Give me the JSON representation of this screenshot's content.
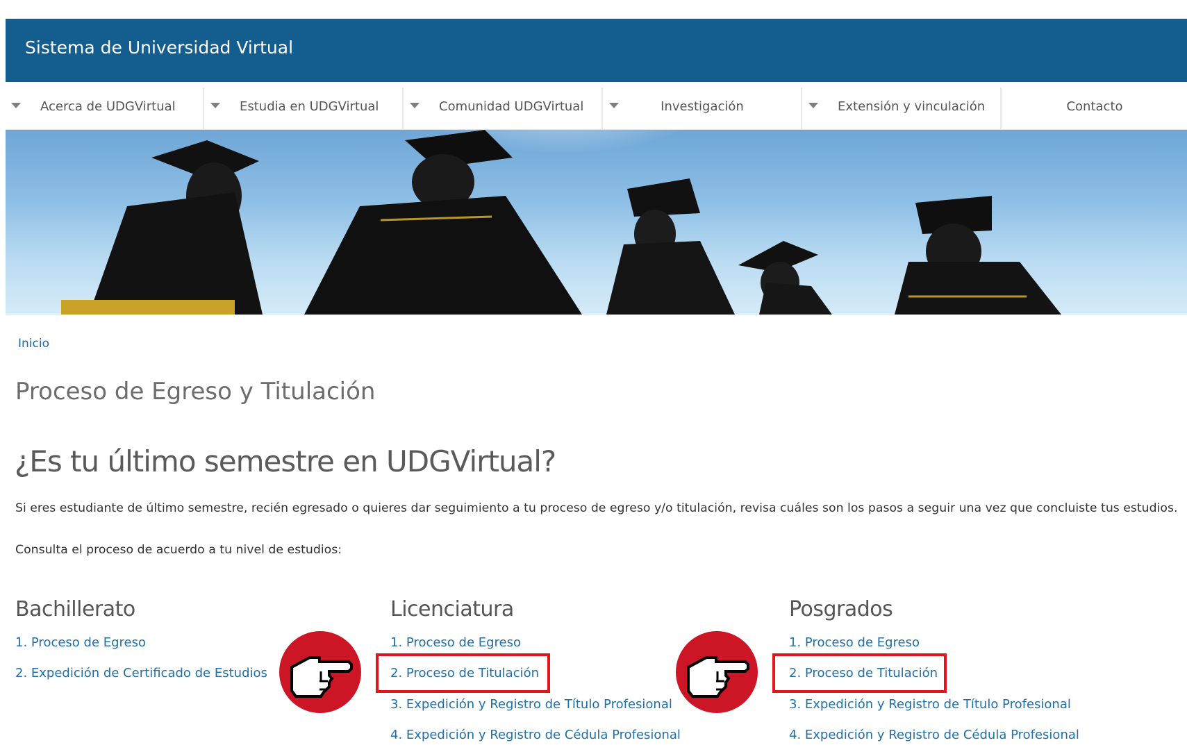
{
  "header": {
    "site_title": "Sistema de Universidad Virtual"
  },
  "nav": {
    "items": [
      {
        "label": "Acerca de UDGVirtual",
        "has_caret": true
      },
      {
        "label": "Estudia en UDGVirtual",
        "has_caret": true
      },
      {
        "label": "Comunidad UDGVirtual",
        "has_caret": true
      },
      {
        "label": "Investigación",
        "has_caret": true
      },
      {
        "label": "Extensión y vinculación",
        "has_caret": true
      },
      {
        "label": "Contacto",
        "has_caret": false
      }
    ]
  },
  "breadcrumb": {
    "home": "Inicio"
  },
  "page": {
    "title": "Proceso de Egreso y Titulación",
    "heading": "¿Es tu último semestre en UDGVirtual?",
    "intro": "Si eres estudiante de último semestre, recién egresado o quieres dar seguimiento a tu proceso de egreso y/o titulación, revisa cuáles son los pasos a seguir una vez que concluiste tus estudios.",
    "consult": "Consulta el proceso de acuerdo a tu nivel de estudios:"
  },
  "columns": [
    {
      "heading": "Bachillerato",
      "links": [
        "1. Proceso de Egreso",
        "2. Expedición de Certificado de Estudios"
      ]
    },
    {
      "heading": "Licenciatura",
      "links": [
        "1. Proceso de Egreso",
        "2. Proceso de Titulación",
        "3. Expedición y Registro de Título Profesional",
        "4. Expedición y Registro de Cédula Profesional"
      ]
    },
    {
      "heading": "Posgrados",
      "links": [
        "1. Proceso de Egreso",
        "2. Proceso de Titulación",
        "3. Expedición y Registro de Título Profesional",
        "4. Expedición y Registro de Cédula Profesional"
      ]
    }
  ],
  "annotations": {
    "pointer_icon": "hand-pointing-right-icon",
    "highlight_color": "#e0161c",
    "badge_color": "#cc1525"
  },
  "colors": {
    "header_bg": "#135d8f",
    "link": "#1f6fa8"
  }
}
